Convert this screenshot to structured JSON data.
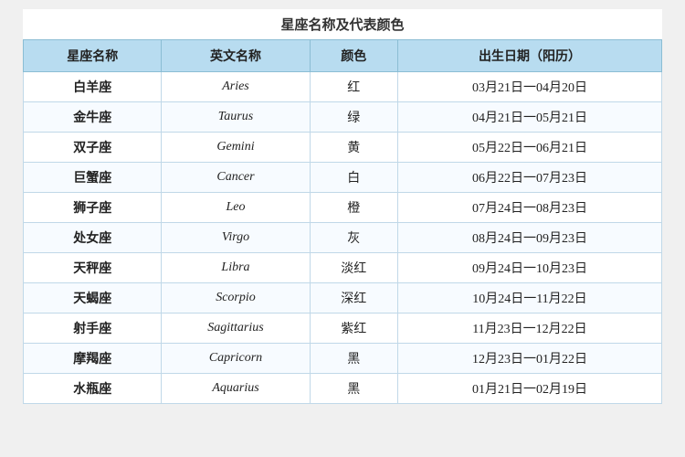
{
  "title": "星座名称及代表颜色",
  "headers": [
    "星座名称",
    "英文名称",
    "颜色",
    "出生日期（阳历）"
  ],
  "rows": [
    {
      "zh": "白羊座",
      "en": "Aries",
      "color": "红",
      "dates": "03月21日一04月20日"
    },
    {
      "zh": "金牛座",
      "en": "Taurus",
      "color": "绿",
      "dates": "04月21日一05月21日"
    },
    {
      "zh": "双子座",
      "en": "Gemini",
      "color": "黄",
      "dates": "05月22日一06月21日"
    },
    {
      "zh": "巨蟹座",
      "en": "Cancer",
      "color": "白",
      "dates": "06月22日一07月23日"
    },
    {
      "zh": "狮子座",
      "en": "Leo",
      "color": "橙",
      "dates": "07月24日一08月23日"
    },
    {
      "zh": "处女座",
      "en": "Virgo",
      "color": "灰",
      "dates": "08月24日一09月23日"
    },
    {
      "zh": "天秤座",
      "en": "Libra",
      "color": "淡红",
      "dates": "09月24日一10月23日"
    },
    {
      "zh": "天蝎座",
      "en": "Scorpio",
      "color": "深红",
      "dates": "10月24日一11月22日"
    },
    {
      "zh": "射手座",
      "en": "Sagittarius",
      "color": "紫红",
      "dates": "11月23日一12月22日"
    },
    {
      "zh": "摩羯座",
      "en": "Capricorn",
      "color": "黑",
      "dates": "12月23日一01月22日"
    },
    {
      "zh": "水瓶座",
      "en": "Aquarius",
      "color": "黑",
      "dates": "01月21日一02月19日"
    }
  ]
}
